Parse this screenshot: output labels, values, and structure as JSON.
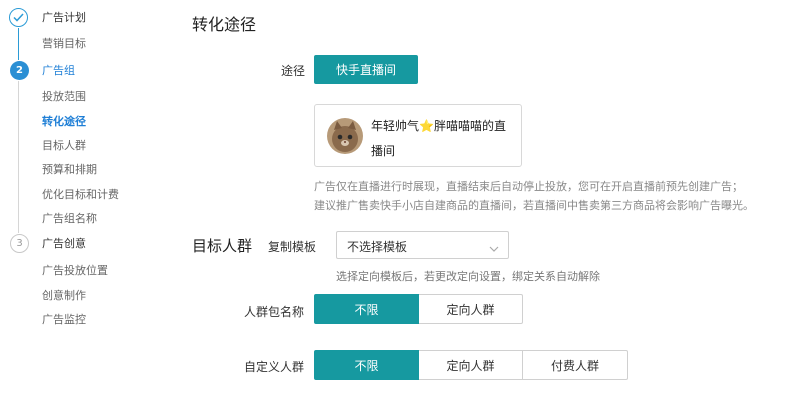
{
  "sidebar": {
    "steps": [
      {
        "label": "广告计划",
        "number": ""
      },
      {
        "label": "广告组",
        "number": "2"
      },
      {
        "label": "广告创意",
        "number": "3"
      }
    ],
    "plan_items": [
      "营销目标"
    ],
    "group_items": [
      "投放范围",
      "转化途径",
      "目标人群",
      "预算和排期",
      "优化目标和计费",
      "广告组名称"
    ],
    "creative_items": [
      "广告投放位置",
      "创意制作",
      "广告监控"
    ]
  },
  "conversion": {
    "title": "转化途径",
    "path_label": "途径",
    "path_button": "快手直播间",
    "card_name": "年轻帅气⭐胖喵喵喵的直播间",
    "note_line1": "广告仅在直播进行时展现，直播结束后自动停止投放，您可在开启直播前预先创建广告；",
    "note_line2": "建议推广售卖快手小店自建商品的直播间，若直播间中售卖第三方商品将会影响广告曝光。"
  },
  "audience": {
    "title": "目标人群",
    "template_label": "复制模板",
    "template_value": "不选择模板",
    "template_hint": "选择定向模板后，若更改定向设置，绑定关系自动解除",
    "package_label": "人群包名称",
    "package_options": [
      "不限",
      "定向人群"
    ],
    "package_selected": "不限",
    "custom_label": "自定义人群",
    "custom_options": [
      "不限",
      "定向人群",
      "付费人群"
    ],
    "custom_selected": "不限"
  },
  "colors": {
    "accent": "#1699a0",
    "step_blue": "#2b8fd4",
    "link_blue": "#1f7fd6"
  }
}
